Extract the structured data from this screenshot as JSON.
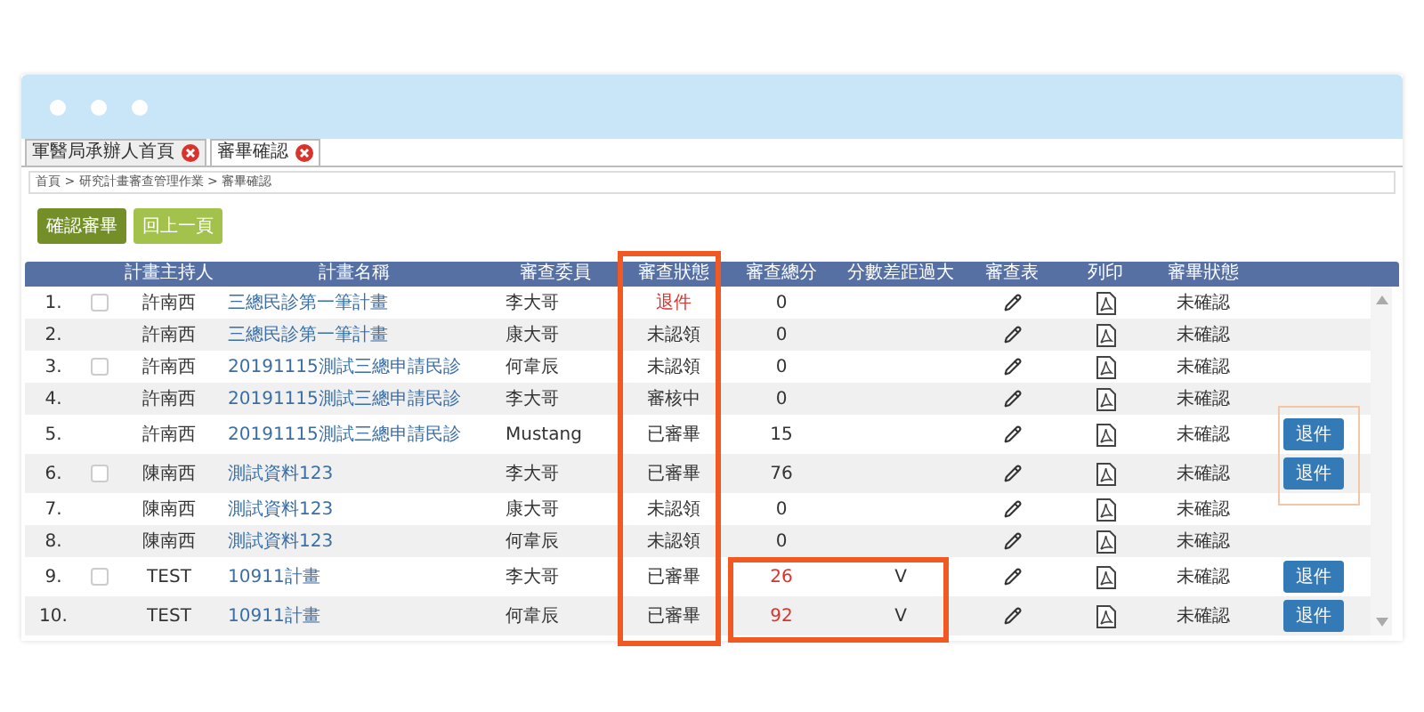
{
  "tabs": [
    {
      "label": "軍醫局承辦人首頁",
      "selected": false
    },
    {
      "label": "審畢確認",
      "selected": true
    }
  ],
  "breadcrumb": "首頁 > 研究計畫審查管理作業 > 審畢確認",
  "actions": [
    {
      "label": "確認審畢",
      "kind": "primary"
    },
    {
      "label": "回上一頁",
      "kind": "secondary"
    }
  ],
  "table": {
    "columns": [
      "計畫主持人",
      "計畫名稱",
      "審查委員",
      "審查狀態",
      "審查總分",
      "分數差距過大",
      "審查表",
      "列印",
      "審畢狀態"
    ],
    "rows": [
      {
        "number": "1.",
        "checked": false,
        "host": "許南西",
        "plan": "三總民診第一筆計畫",
        "reviewer": "李大哥",
        "status": "退件",
        "status_returned": true,
        "score": "0",
        "score_alert": false,
        "confirm": "未確認"
      },
      {
        "number": "2.",
        "host": "許南西",
        "plan": "三總民診第一筆計畫",
        "reviewer": "康大哥",
        "status": "未認領",
        "status_returned": false,
        "score": "0",
        "score_alert": false,
        "confirm": "未確認"
      },
      {
        "number": "3.",
        "checked": false,
        "host": "許南西",
        "plan": "20191115測試三總申請民診",
        "reviewer": "何韋辰",
        "status": "未認領",
        "status_returned": false,
        "score": "0",
        "score_alert": false,
        "confirm": "未確認"
      },
      {
        "number": "4.",
        "host": "許南西",
        "plan": "20191115測試三總申請民診",
        "reviewer": "李大哥",
        "status": "審核中",
        "status_returned": false,
        "score": "0",
        "score_alert": false,
        "confirm": "未確認"
      },
      {
        "number": "5.",
        "host": "許南西",
        "plan": "20191115測試三總申請民診",
        "reviewer": "Mustang",
        "status": "已審畢",
        "status_returned": false,
        "score": "15",
        "score_alert": false,
        "confirm": "未確認",
        "button": "退件"
      },
      {
        "number": "6.",
        "checked": false,
        "host": "陳南西",
        "plan": "測試資料123",
        "reviewer": "李大哥",
        "status": "已審畢",
        "status_returned": false,
        "score": "76",
        "score_alert": false,
        "confirm": "未確認",
        "button": "退件"
      },
      {
        "number": "7.",
        "host": "陳南西",
        "plan": "測試資料123",
        "reviewer": "康大哥",
        "status": "未認領",
        "status_returned": false,
        "score": "0",
        "score_alert": false,
        "confirm": "未確認"
      },
      {
        "number": "8.",
        "host": "陳南西",
        "plan": "測試資料123",
        "reviewer": "何韋辰",
        "status": "未認領",
        "status_returned": false,
        "score": "0",
        "score_alert": false,
        "confirm": "未確認"
      },
      {
        "number": "9.",
        "checked": false,
        "host": "TEST",
        "plan": "10911計畫",
        "reviewer": "李大哥",
        "status": "已審畢",
        "status_returned": false,
        "score": "26",
        "score_alert": true,
        "gap": "V",
        "confirm": "未確認",
        "button": "退件"
      },
      {
        "number": "10.",
        "host": "TEST",
        "plan": "10911計畫",
        "reviewer": "何韋辰",
        "status": "已審畢",
        "status_returned": false,
        "score": "92",
        "score_alert": true,
        "gap": "V",
        "confirm": "未確認",
        "button": "退件"
      }
    ]
  },
  "highlights": [
    {
      "kind": "status-column"
    },
    {
      "kind": "score-rows"
    },
    {
      "kind": "return-buttons"
    }
  ]
}
